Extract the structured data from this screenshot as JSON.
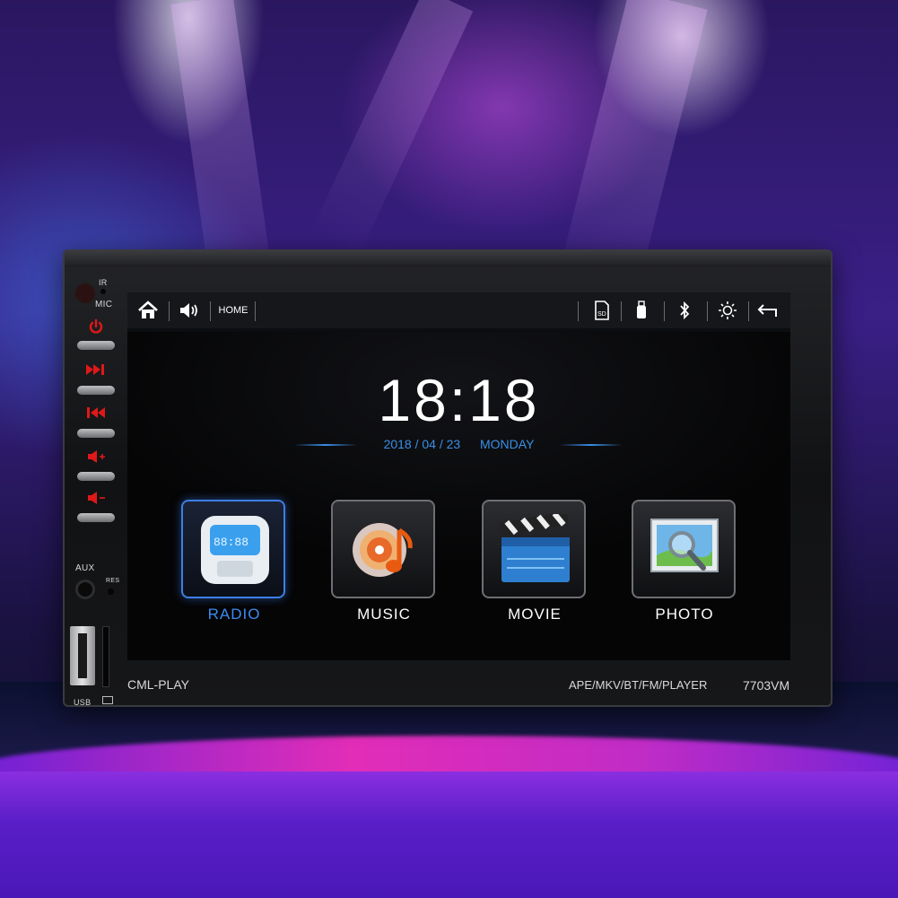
{
  "device": {
    "brand": "CML-PLAY",
    "formats": "APE/MKV/BT/FM/PLAYER",
    "model": "7703VM",
    "labels": {
      "ir": "IR",
      "mic": "MIC",
      "aux": "AUX",
      "res": "RES",
      "usb": "USB"
    }
  },
  "side_buttons": [
    {
      "name": "power-button",
      "icon": "power-icon"
    },
    {
      "name": "next-track-button",
      "icon": "next-icon"
    },
    {
      "name": "prev-track-button",
      "icon": "previous-icon"
    },
    {
      "name": "volume-up-button",
      "icon": "volume-up-icon"
    },
    {
      "name": "volume-down-button",
      "icon": "volume-down-icon"
    }
  ],
  "statusbar": {
    "home_label": "HOME",
    "left_icons": [
      "home-icon",
      "volume-icon"
    ],
    "right_icons": [
      "sd-card-icon",
      "usb-icon",
      "bluetooth-icon",
      "brightness-icon",
      "back-icon"
    ]
  },
  "main": {
    "time": "18:18",
    "date": "2018 / 04 / 23",
    "weekday": "MONDAY"
  },
  "apps": [
    {
      "label": "RADIO",
      "icon": "radio-icon",
      "active": true
    },
    {
      "label": "MUSIC",
      "icon": "music-icon",
      "active": false
    },
    {
      "label": "MOVIE",
      "icon": "movie-icon",
      "active": false
    },
    {
      "label": "PHOTO",
      "icon": "photo-icon",
      "active": false
    }
  ],
  "colors": {
    "accent": "#3d8cf0",
    "button_red": "#e01818"
  }
}
